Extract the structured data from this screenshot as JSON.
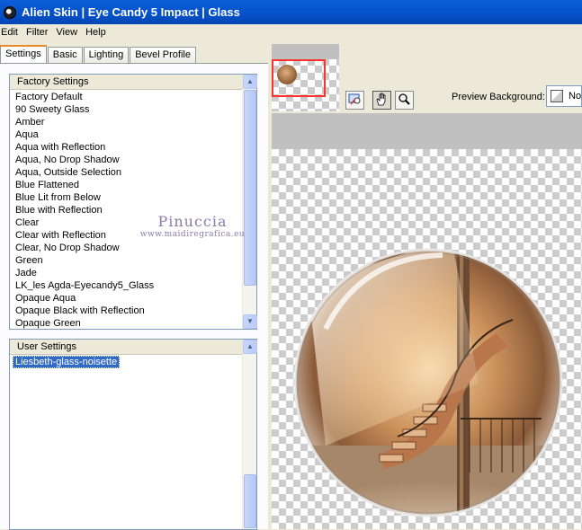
{
  "window": {
    "title": "Alien Skin  |  Eye Candy 5 Impact  |  Glass"
  },
  "menu": {
    "items": [
      "Edit",
      "Filter",
      "View",
      "Help"
    ]
  },
  "tabs": [
    "Settings",
    "Basic",
    "Lighting",
    "Bevel Profile"
  ],
  "factory_settings": {
    "header": "Factory Settings",
    "items": [
      "Factory Default",
      "90 Sweety Glass",
      "Amber",
      "Aqua",
      "Aqua with Reflection",
      "Aqua, No Drop Shadow",
      "Aqua, Outside Selection",
      "Blue Flattened",
      "Blue Lit from Below",
      "Blue with Reflection",
      "Clear",
      "Clear with Reflection",
      "Clear, No Drop Shadow",
      "Green",
      "Jade",
      "LK_les Agda-Eyecandy5_Glass",
      "Opaque Aqua",
      "Opaque Black with Reflection",
      "Opaque Green"
    ]
  },
  "user_settings": {
    "header": "User Settings",
    "items": [
      "Liesbeth-glass-noisette"
    ],
    "selected": "Liesbeth-glass-noisette"
  },
  "preview": {
    "background_label": "Preview Background:",
    "background_value": "No"
  },
  "watermark": {
    "line1": "Pinuccia",
    "line2": "www.maidiregrafica.eu"
  },
  "colors": {
    "titlebar": "#0550c8",
    "selection": "#316ac5",
    "active_tab_accent": "#e68b2c"
  },
  "icons": {
    "app": "alien-skin-icon",
    "tools": [
      "navigator-hand-icon",
      "hand-icon",
      "zoom-icon"
    ]
  }
}
